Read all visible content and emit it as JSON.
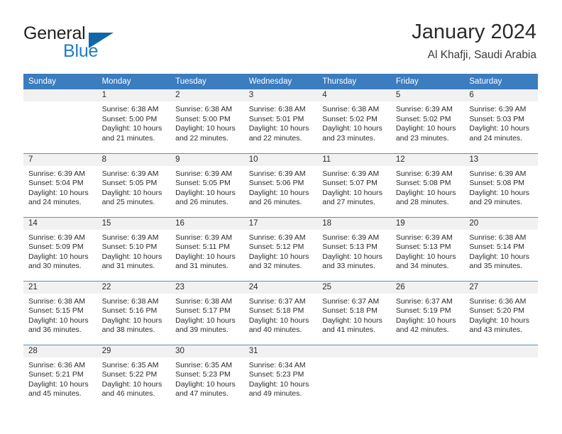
{
  "brand": {
    "word1": "General",
    "word2": "Blue",
    "flag_icon": "triangle-flag-icon",
    "color_dark": "#231f20",
    "color_blue": "#1d7cc4"
  },
  "header": {
    "title": "January 2024",
    "subtitle": "Al Khafji, Saudi Arabia"
  },
  "theme": {
    "header_blue": "#3b7dbf",
    "daynum_band": "#f1f1f1",
    "row_divider": "#5b8fc4",
    "text": "#2b2b2b"
  },
  "calendar": {
    "weekday_headers": [
      "Sunday",
      "Monday",
      "Tuesday",
      "Wednesday",
      "Thursday",
      "Friday",
      "Saturday"
    ],
    "weeks": [
      [
        {
          "day": "",
          "empty": true,
          "sunrise": "",
          "sunset": "",
          "daylight1": "",
          "daylight2": ""
        },
        {
          "day": "1",
          "empty": false,
          "sunrise": "Sunrise: 6:38 AM",
          "sunset": "Sunset: 5:00 PM",
          "daylight1": "Daylight: 10 hours",
          "daylight2": "and 21 minutes."
        },
        {
          "day": "2",
          "empty": false,
          "sunrise": "Sunrise: 6:38 AM",
          "sunset": "Sunset: 5:00 PM",
          "daylight1": "Daylight: 10 hours",
          "daylight2": "and 22 minutes."
        },
        {
          "day": "3",
          "empty": false,
          "sunrise": "Sunrise: 6:38 AM",
          "sunset": "Sunset: 5:01 PM",
          "daylight1": "Daylight: 10 hours",
          "daylight2": "and 22 minutes."
        },
        {
          "day": "4",
          "empty": false,
          "sunrise": "Sunrise: 6:38 AM",
          "sunset": "Sunset: 5:02 PM",
          "daylight1": "Daylight: 10 hours",
          "daylight2": "and 23 minutes."
        },
        {
          "day": "5",
          "empty": false,
          "sunrise": "Sunrise: 6:39 AM",
          "sunset": "Sunset: 5:02 PM",
          "daylight1": "Daylight: 10 hours",
          "daylight2": "and 23 minutes."
        },
        {
          "day": "6",
          "empty": false,
          "sunrise": "Sunrise: 6:39 AM",
          "sunset": "Sunset: 5:03 PM",
          "daylight1": "Daylight: 10 hours",
          "daylight2": "and 24 minutes."
        }
      ],
      [
        {
          "day": "7",
          "empty": false,
          "sunrise": "Sunrise: 6:39 AM",
          "sunset": "Sunset: 5:04 PM",
          "daylight1": "Daylight: 10 hours",
          "daylight2": "and 24 minutes."
        },
        {
          "day": "8",
          "empty": false,
          "sunrise": "Sunrise: 6:39 AM",
          "sunset": "Sunset: 5:05 PM",
          "daylight1": "Daylight: 10 hours",
          "daylight2": "and 25 minutes."
        },
        {
          "day": "9",
          "empty": false,
          "sunrise": "Sunrise: 6:39 AM",
          "sunset": "Sunset: 5:05 PM",
          "daylight1": "Daylight: 10 hours",
          "daylight2": "and 26 minutes."
        },
        {
          "day": "10",
          "empty": false,
          "sunrise": "Sunrise: 6:39 AM",
          "sunset": "Sunset: 5:06 PM",
          "daylight1": "Daylight: 10 hours",
          "daylight2": "and 26 minutes."
        },
        {
          "day": "11",
          "empty": false,
          "sunrise": "Sunrise: 6:39 AM",
          "sunset": "Sunset: 5:07 PM",
          "daylight1": "Daylight: 10 hours",
          "daylight2": "and 27 minutes."
        },
        {
          "day": "12",
          "empty": false,
          "sunrise": "Sunrise: 6:39 AM",
          "sunset": "Sunset: 5:08 PM",
          "daylight1": "Daylight: 10 hours",
          "daylight2": "and 28 minutes."
        },
        {
          "day": "13",
          "empty": false,
          "sunrise": "Sunrise: 6:39 AM",
          "sunset": "Sunset: 5:08 PM",
          "daylight1": "Daylight: 10 hours",
          "daylight2": "and 29 minutes."
        }
      ],
      [
        {
          "day": "14",
          "empty": false,
          "sunrise": "Sunrise: 6:39 AM",
          "sunset": "Sunset: 5:09 PM",
          "daylight1": "Daylight: 10 hours",
          "daylight2": "and 30 minutes."
        },
        {
          "day": "15",
          "empty": false,
          "sunrise": "Sunrise: 6:39 AM",
          "sunset": "Sunset: 5:10 PM",
          "daylight1": "Daylight: 10 hours",
          "daylight2": "and 31 minutes."
        },
        {
          "day": "16",
          "empty": false,
          "sunrise": "Sunrise: 6:39 AM",
          "sunset": "Sunset: 5:11 PM",
          "daylight1": "Daylight: 10 hours",
          "daylight2": "and 31 minutes."
        },
        {
          "day": "17",
          "empty": false,
          "sunrise": "Sunrise: 6:39 AM",
          "sunset": "Sunset: 5:12 PM",
          "daylight1": "Daylight: 10 hours",
          "daylight2": "and 32 minutes."
        },
        {
          "day": "18",
          "empty": false,
          "sunrise": "Sunrise: 6:39 AM",
          "sunset": "Sunset: 5:13 PM",
          "daylight1": "Daylight: 10 hours",
          "daylight2": "and 33 minutes."
        },
        {
          "day": "19",
          "empty": false,
          "sunrise": "Sunrise: 6:39 AM",
          "sunset": "Sunset: 5:13 PM",
          "daylight1": "Daylight: 10 hours",
          "daylight2": "and 34 minutes."
        },
        {
          "day": "20",
          "empty": false,
          "sunrise": "Sunrise: 6:38 AM",
          "sunset": "Sunset: 5:14 PM",
          "daylight1": "Daylight: 10 hours",
          "daylight2": "and 35 minutes."
        }
      ],
      [
        {
          "day": "21",
          "empty": false,
          "sunrise": "Sunrise: 6:38 AM",
          "sunset": "Sunset: 5:15 PM",
          "daylight1": "Daylight: 10 hours",
          "daylight2": "and 36 minutes."
        },
        {
          "day": "22",
          "empty": false,
          "sunrise": "Sunrise: 6:38 AM",
          "sunset": "Sunset: 5:16 PM",
          "daylight1": "Daylight: 10 hours",
          "daylight2": "and 38 minutes."
        },
        {
          "day": "23",
          "empty": false,
          "sunrise": "Sunrise: 6:38 AM",
          "sunset": "Sunset: 5:17 PM",
          "daylight1": "Daylight: 10 hours",
          "daylight2": "and 39 minutes."
        },
        {
          "day": "24",
          "empty": false,
          "sunrise": "Sunrise: 6:37 AM",
          "sunset": "Sunset: 5:18 PM",
          "daylight1": "Daylight: 10 hours",
          "daylight2": "and 40 minutes."
        },
        {
          "day": "25",
          "empty": false,
          "sunrise": "Sunrise: 6:37 AM",
          "sunset": "Sunset: 5:18 PM",
          "daylight1": "Daylight: 10 hours",
          "daylight2": "and 41 minutes."
        },
        {
          "day": "26",
          "empty": false,
          "sunrise": "Sunrise: 6:37 AM",
          "sunset": "Sunset: 5:19 PM",
          "daylight1": "Daylight: 10 hours",
          "daylight2": "and 42 minutes."
        },
        {
          "day": "27",
          "empty": false,
          "sunrise": "Sunrise: 6:36 AM",
          "sunset": "Sunset: 5:20 PM",
          "daylight1": "Daylight: 10 hours",
          "daylight2": "and 43 minutes."
        }
      ],
      [
        {
          "day": "28",
          "empty": false,
          "sunrise": "Sunrise: 6:36 AM",
          "sunset": "Sunset: 5:21 PM",
          "daylight1": "Daylight: 10 hours",
          "daylight2": "and 45 minutes."
        },
        {
          "day": "29",
          "empty": false,
          "sunrise": "Sunrise: 6:35 AM",
          "sunset": "Sunset: 5:22 PM",
          "daylight1": "Daylight: 10 hours",
          "daylight2": "and 46 minutes."
        },
        {
          "day": "30",
          "empty": false,
          "sunrise": "Sunrise: 6:35 AM",
          "sunset": "Sunset: 5:23 PM",
          "daylight1": "Daylight: 10 hours",
          "daylight2": "and 47 minutes."
        },
        {
          "day": "31",
          "empty": false,
          "sunrise": "Sunrise: 6:34 AM",
          "sunset": "Sunset: 5:23 PM",
          "daylight1": "Daylight: 10 hours",
          "daylight2": "and 49 minutes."
        },
        {
          "day": "",
          "empty": true,
          "sunrise": "",
          "sunset": "",
          "daylight1": "",
          "daylight2": ""
        },
        {
          "day": "",
          "empty": true,
          "sunrise": "",
          "sunset": "",
          "daylight1": "",
          "daylight2": ""
        },
        {
          "day": "",
          "empty": true,
          "sunrise": "",
          "sunset": "",
          "daylight1": "",
          "daylight2": ""
        }
      ]
    ]
  }
}
